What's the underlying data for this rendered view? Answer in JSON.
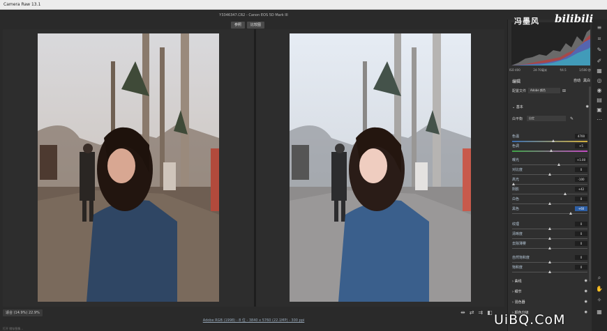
{
  "titlebar": {
    "title": "Camera Raw 13.1"
  },
  "file": {
    "name": "Y3346347.CR2  -  Canon EOS 5D Mark III"
  },
  "toggles": {
    "before": "参照",
    "after": "比较图"
  },
  "footer": {
    "zoom": "适合 (14.9%)   22.9%",
    "info": "Adobe RGB (1998) - 8 位 - 3840 x 5760 (22.1MP) - 300 ppi",
    "left_small": "打开              储存图像..."
  },
  "histogram": {
    "readout": "-   -   -"
  },
  "camera_info": {
    "iso": "ISO 400",
    "lens": "24-70毫米",
    "aperture": "f/4.5",
    "shutter": "1/500 秒"
  },
  "panel": {
    "title": "编辑",
    "auto_label": "自动",
    "bw_label": "黑白",
    "profile_label": "配置文件",
    "profile_value": "Adobe 颜色",
    "basic_label": "基本",
    "wb_label": "白平衡",
    "wb_value": "自定"
  },
  "sliders": [
    {
      "label": "色温",
      "value": "4700",
      "pos": 0.55,
      "kind": "temp",
      "active": false
    },
    {
      "label": "色调",
      "value": "+5",
      "pos": 0.52,
      "kind": "tint",
      "active": false
    },
    {
      "label": "曝光",
      "value": "+1.00",
      "pos": 0.62,
      "kind": "",
      "active": false
    },
    {
      "label": "对比度",
      "value": "0",
      "pos": 0.5,
      "kind": "",
      "active": false
    },
    {
      "label": "高光",
      "value": "-100",
      "pos": 0.02,
      "kind": "",
      "active": false
    },
    {
      "label": "阴影",
      "value": "+42",
      "pos": 0.7,
      "kind": "",
      "active": false
    },
    {
      "label": "白色",
      "value": "0",
      "pos": 0.5,
      "kind": "",
      "active": false
    },
    {
      "label": "黑色",
      "value": "+60",
      "pos": 0.78,
      "kind": "",
      "active": true
    },
    {
      "label": "纹理",
      "value": "0",
      "pos": 0.5,
      "kind": "",
      "active": false
    },
    {
      "label": "清晰度",
      "value": "0",
      "pos": 0.5,
      "kind": "",
      "active": false
    },
    {
      "label": "去除薄雾",
      "value": "0",
      "pos": 0.5,
      "kind": "",
      "active": false
    },
    {
      "label": "自然饱和度",
      "value": "0",
      "pos": 0.5,
      "kind": "",
      "active": false
    },
    {
      "label": "饱和度",
      "value": "0",
      "pos": 0.5,
      "kind": "",
      "active": false
    }
  ],
  "sections": [
    {
      "label": "曲线"
    },
    {
      "label": "细节"
    },
    {
      "label": "混色器"
    },
    {
      "label": "颜色分级"
    }
  ],
  "watermarks": {
    "top": "冯墨风",
    "bili": "bilibili",
    "bottom": "UiBQ.CoM"
  },
  "colors": {
    "panel_bg": "#2f2f2f",
    "active_value": "#2d5fa6",
    "label_blue": "#b5c7d8"
  }
}
